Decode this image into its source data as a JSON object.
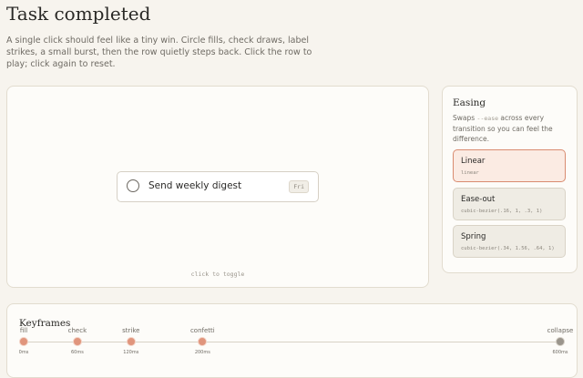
{
  "header": {
    "title": "Task completed",
    "subtitle": "A single click should feel like a tiny win. Circle fills, check draws, label strikes, a small burst, then the row quietly steps back. Click the row to play; click again to reset."
  },
  "stage": {
    "task_label": "Send weekly digest",
    "task_day": "Fri",
    "hint": "click to toggle"
  },
  "easing": {
    "title": "Easing",
    "desc_prefix": "Swaps ",
    "desc_code": "--ease",
    "desc_suffix": " across every transition so you can feel the difference.",
    "options": [
      {
        "name": "Linear",
        "code": "linear",
        "selected": true
      },
      {
        "name": "Ease-out",
        "code": "cubic-bezier(.16, 1, .3, 1)",
        "selected": false
      },
      {
        "name": "Spring",
        "code": "cubic-bezier(.34, 1.56, .64, 1)",
        "selected": false
      }
    ]
  },
  "keyframes": {
    "title": "Keyframes",
    "total_ms": 600,
    "items": [
      {
        "label": "fill",
        "time": "0ms",
        "ms": 0
      },
      {
        "label": "check",
        "time": "60ms",
        "ms": 60
      },
      {
        "label": "strike",
        "time": "120ms",
        "ms": 120
      },
      {
        "label": "confetti",
        "time": "200ms",
        "ms": 200
      },
      {
        "label": "collapse",
        "time": "600ms",
        "ms": 600
      }
    ]
  },
  "colors": {
    "accent": "#e0957c",
    "accent_light": "#fbebe3",
    "background": "#f7f4ee"
  }
}
